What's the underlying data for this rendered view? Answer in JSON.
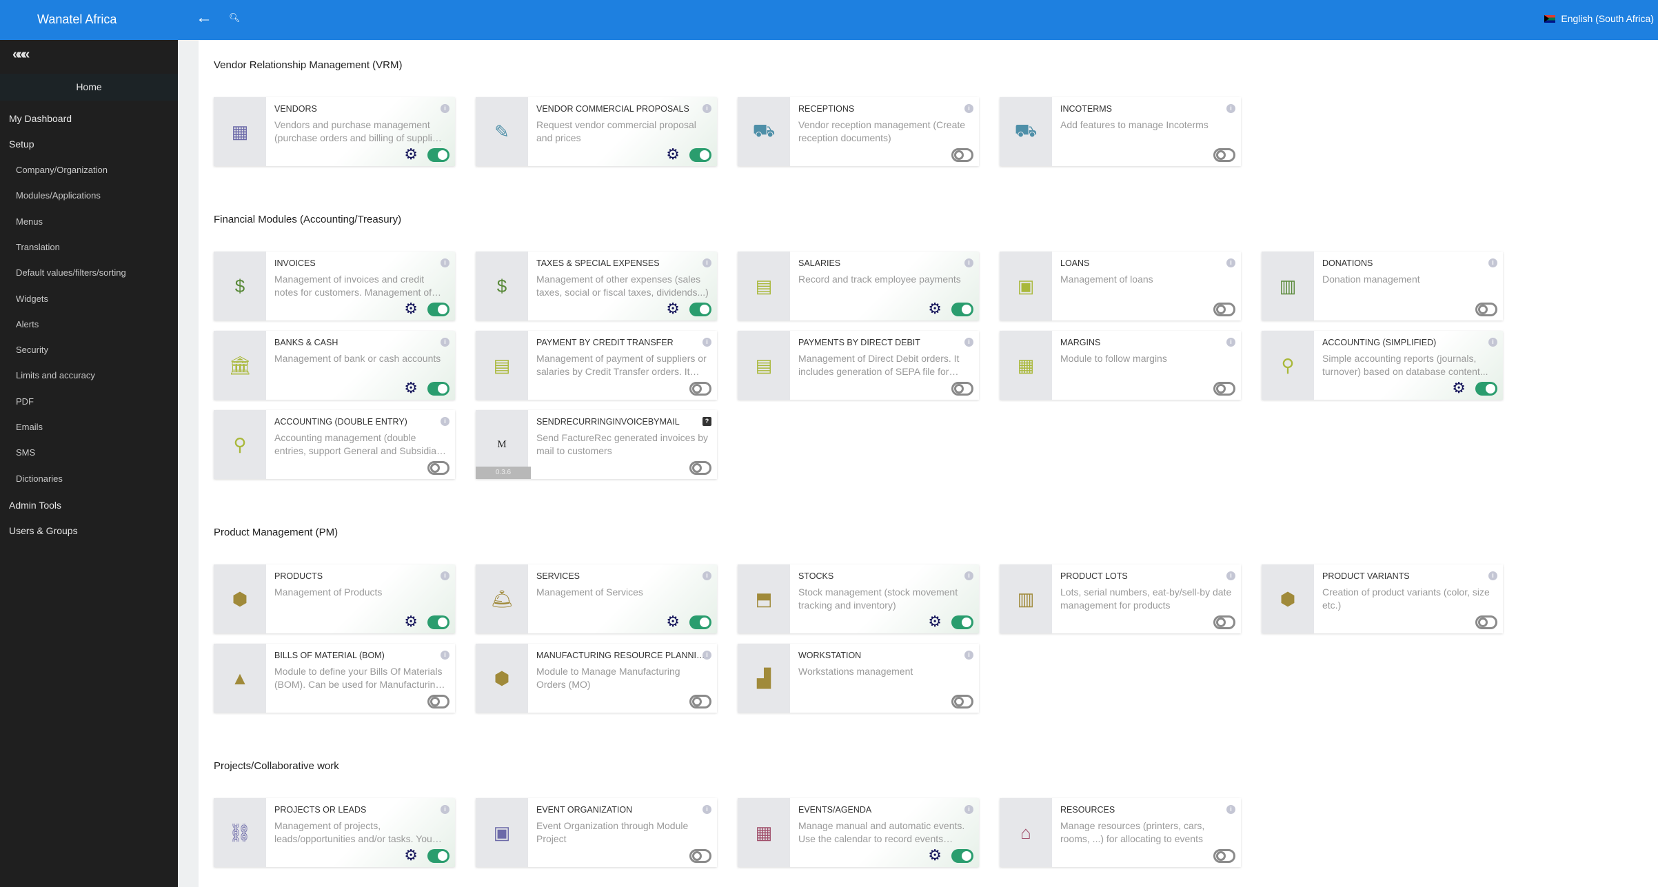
{
  "header": {
    "brand": "Wanatel Africa",
    "back_icon": "arrow-left-icon",
    "search_icon": "search-icon",
    "language": "English (South Africa)"
  },
  "sidebar": {
    "collapse_label": "«««",
    "home": "Home",
    "top_items": [
      "My Dashboard",
      "Setup"
    ],
    "setup_items": [
      "Company/Organization",
      "Modules/Applications",
      "Menus",
      "Translation",
      "Default values/filters/sorting",
      "Widgets",
      "Alerts",
      "Security",
      "Limits and accuracy",
      "PDF",
      "Emails",
      "SMS",
      "Dictionaries"
    ],
    "bottom_items": [
      "Admin Tools",
      "Users & Groups"
    ]
  },
  "colors": {
    "accent": "#1e80e0",
    "toggle_on": "#2a9d6e",
    "gear": "#14145a"
  },
  "sections": [
    {
      "title": "Vendor Relationship Management (VRM)",
      "cards": [
        {
          "title": "VENDORS",
          "desc": "Vendors and purchase management (purchase orders and billing of supplier invoices)",
          "enabled": true,
          "icon": "building-icon",
          "glyph": "▦",
          "color": "#6c6aa8"
        },
        {
          "title": "VENDOR COMMERCIAL PROPOSALS",
          "desc": "Request vendor commercial proposal and prices",
          "enabled": true,
          "icon": "file-signature-icon",
          "glyph": "✎",
          "color": "#4e8fa8"
        },
        {
          "title": "RECEPTIONS",
          "desc": "Vendor reception management (Create reception documents)",
          "enabled": false,
          "icon": "dolly-icon",
          "glyph": "⛟",
          "color": "#4e8fa8"
        },
        {
          "title": "INCOTERMS",
          "desc": "Add features to manage Incoterms",
          "enabled": false,
          "icon": "truck-loading-icon",
          "glyph": "⛟",
          "color": "#4e8fa8"
        }
      ]
    },
    {
      "title": "Financial Modules (Accounting/Treasury)",
      "cards": [
        {
          "title": "INVOICES",
          "desc": "Management of invoices and credit notes for customers. Management of invoices and credit notes for suppliers",
          "enabled": true,
          "icon": "file-invoice-dollar-icon",
          "glyph": "$",
          "color": "#5a8a3a"
        },
        {
          "title": "TAXES & SPECIAL EXPENSES",
          "desc": "Management of other expenses (sales taxes, social or fiscal taxes, dividends...)",
          "enabled": true,
          "icon": "file-invoice-dollar-icon",
          "glyph": "$",
          "color": "#5a8a3a"
        },
        {
          "title": "SALARIES",
          "desc": "Record and track employee payments",
          "enabled": true,
          "icon": "money-check-icon",
          "glyph": "▤",
          "color": "#a9b83a"
        },
        {
          "title": "LOANS",
          "desc": "Management of loans",
          "enabled": false,
          "icon": "money-bill-icon",
          "glyph": "▣",
          "color": "#a9b83a"
        },
        {
          "title": "DONATIONS",
          "desc": "Donation management",
          "enabled": false,
          "icon": "file-alt-icon",
          "glyph": "▥",
          "color": "#5a8a3a"
        },
        {
          "title": "BANKS & CASH",
          "desc": "Management of bank or cash accounts",
          "enabled": true,
          "icon": "university-icon",
          "glyph": "🏛",
          "color": "#a9b83a"
        },
        {
          "title": "PAYMENT BY CREDIT TRANSFER",
          "desc": "Management of payment of suppliers or salaries by Credit Transfer orders. It includes generation of SEPA file",
          "enabled": false,
          "icon": "money-check-icon",
          "glyph": "▤",
          "color": "#a9b83a"
        },
        {
          "title": "PAYMENTS BY DIRECT DEBIT",
          "desc": "Management of Direct Debit orders. It includes generation of SEPA file for European countries",
          "enabled": false,
          "icon": "money-check-icon",
          "glyph": "▤",
          "color": "#a9b83a"
        },
        {
          "title": "MARGINS",
          "desc": "Module to follow margins",
          "enabled": false,
          "icon": "calculator-icon",
          "glyph": "▦",
          "color": "#a9b83a"
        },
        {
          "title": "ACCOUNTING (SIMPLIFIED)",
          "desc": "Simple accounting reports (journals, turnover) based on database content...",
          "enabled": true,
          "icon": "search-dollar-icon",
          "glyph": "⚲",
          "color": "#a9b83a"
        },
        {
          "title": "ACCOUNTING (DOUBLE ENTRY)",
          "desc": "Accounting management (double entries, support General and Subsidiary Ledgers)",
          "enabled": false,
          "icon": "search-dollar-icon",
          "glyph": "⚲",
          "color": "#a9b83a"
        },
        {
          "title": "SENDRECURRINGINVOICEBYMAIL",
          "desc": "Send FactureRec generated invoices by mail to customers",
          "enabled": false,
          "icon": "module-m-icon",
          "glyph": "M",
          "color": "#222",
          "version": "0.3.6",
          "external": true
        }
      ]
    },
    {
      "title": "Product Management (PM)",
      "cards": [
        {
          "title": "PRODUCTS",
          "desc": "Management of Products",
          "enabled": true,
          "icon": "cube-icon",
          "glyph": "⬢",
          "color": "#a08a3a"
        },
        {
          "title": "SERVICES",
          "desc": "Management of Services",
          "enabled": true,
          "icon": "concierge-bell-icon",
          "glyph": "🛎",
          "color": "#a08a3a"
        },
        {
          "title": "STOCKS",
          "desc": "Stock management (stock movement tracking and inventory)",
          "enabled": true,
          "icon": "box-open-icon",
          "glyph": "⬒",
          "color": "#a08a3a"
        },
        {
          "title": "PRODUCT LOTS",
          "desc": "Lots, serial numbers, eat-by/sell-by date management for products",
          "enabled": false,
          "icon": "barcode-icon",
          "glyph": "▥",
          "color": "#a08a3a"
        },
        {
          "title": "PRODUCT VARIANTS",
          "desc": "Creation of product variants (color, size etc.)",
          "enabled": false,
          "icon": "cube-icon",
          "glyph": "⬢",
          "color": "#a08a3a"
        },
        {
          "title": "BILLS OF MATERIAL (BOM)",
          "desc": "Module to define your Bills Of Materials (BOM). Can be used for Manufacturing Resource Planning",
          "enabled": false,
          "icon": "shapes-icon",
          "glyph": "▲",
          "color": "#a08a3a"
        },
        {
          "title": "MANUFACTURING RESOURCE PLANNING",
          "desc": "Module to Manage Manufacturing Orders (MO)",
          "enabled": false,
          "icon": "cubes-icon",
          "glyph": "⬢",
          "color": "#a08a3a"
        },
        {
          "title": "WORKSTATION",
          "desc": "Workstations management",
          "enabled": false,
          "icon": "pallet-icon",
          "glyph": "▟",
          "color": "#a08a3a"
        }
      ]
    },
    {
      "title": "Projects/Collaborative work",
      "cards": [
        {
          "title": "PROJECTS OR LEADS",
          "desc": "Management of projects, leads/opportunities and/or tasks. You can also assign any element to a project",
          "enabled": true,
          "icon": "project-diagram-icon",
          "glyph": "⛓",
          "color": "#6c6aa8"
        },
        {
          "title": "EVENT ORGANIZATION",
          "desc": "Event Organization through Module Project",
          "enabled": false,
          "icon": "chalkboard-teacher-icon",
          "glyph": "▣",
          "color": "#6c6aa8"
        },
        {
          "title": "EVENTS/AGENDA",
          "desc": "Manage manual and automatic events. Use the calendar to record events manually",
          "enabled": true,
          "icon": "calendar-icon",
          "glyph": "▦",
          "color": "#a04e6a"
        },
        {
          "title": "RESOURCES",
          "desc": "Manage resources (printers, cars, rooms, ...) for allocating to events",
          "enabled": false,
          "icon": "house-user-icon",
          "glyph": "⌂",
          "color": "#a04e6a"
        }
      ]
    }
  ]
}
